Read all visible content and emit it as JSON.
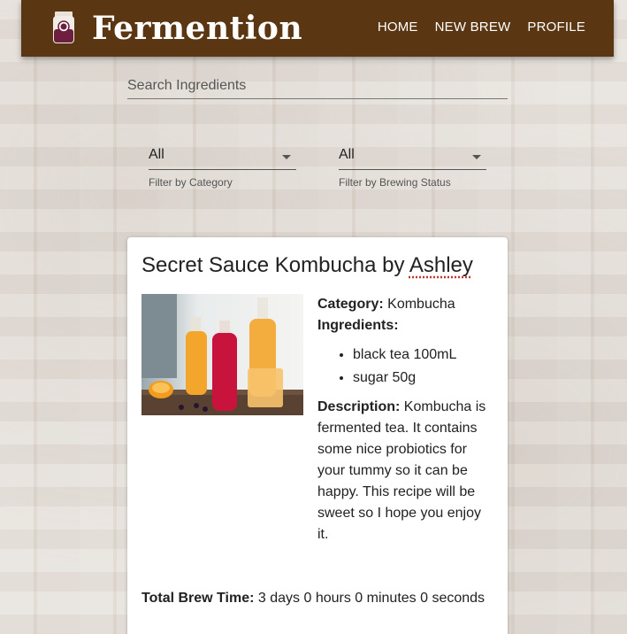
{
  "navbar": {
    "brand": "Fermention",
    "links": [
      "HOME",
      "NEW BREW",
      "PROFILE"
    ],
    "color": "#5a3613"
  },
  "search": {
    "placeholder": "Search Ingredients",
    "value": ""
  },
  "filters": {
    "category": {
      "value": "All",
      "helper": "Filter by Category"
    },
    "status": {
      "value": "All",
      "helper": "Filter by Brewing Status"
    }
  },
  "card": {
    "title": "Secret Sauce Kombucha by",
    "author": "Ashley",
    "category_label": "Category:",
    "category": "Kombucha",
    "ingredients_label": "Ingredients:",
    "ingredients": [
      "black tea 100mL",
      "sugar 50g"
    ],
    "description_label": "Description:",
    "description": "Kombucha is fermented tea. It contains some nice probiotics for your tummy so it can be happy. This recipe will be sweet so I hope you enjoy it.",
    "brew_time_label": "Total Brew Time:",
    "brew_time": "3 days 0 hours 0 minutes 0 seconds"
  }
}
